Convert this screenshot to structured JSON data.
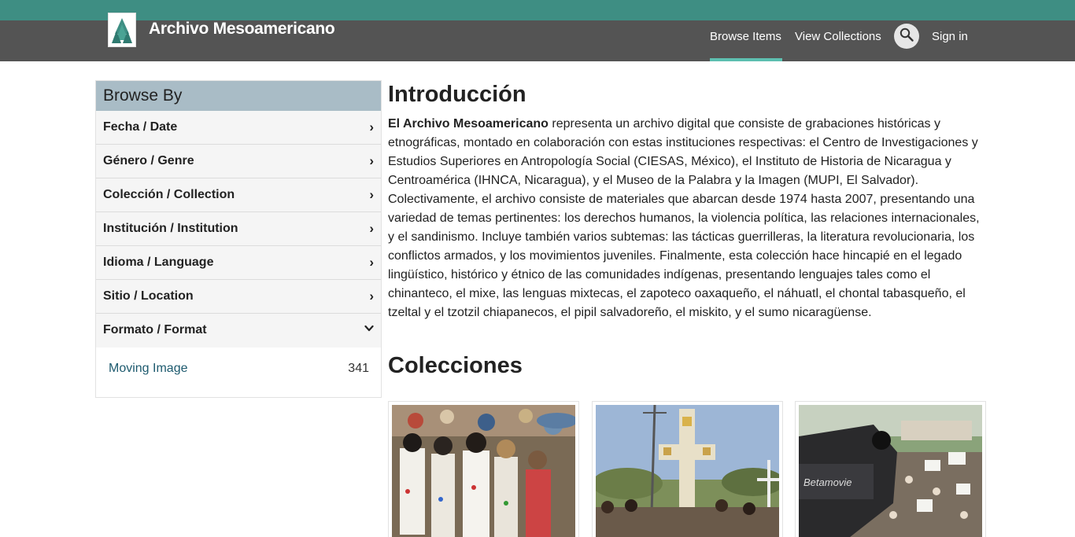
{
  "header": {
    "brand": "Archivo Mesoamericano",
    "nav": {
      "browse_items": "Browse Items",
      "view_collections": "View Collections",
      "sign_in": "Sign in"
    },
    "search_icon": "magnifier-icon",
    "colors": {
      "top_strip": "#3e8e83",
      "navbar": "#545454",
      "active_underline": "#5cbfb0"
    }
  },
  "sidebar": {
    "title": "Browse By",
    "facets": [
      {
        "label": "Fecha / Date",
        "icon": "chevron-right-icon",
        "glyph": "›"
      },
      {
        "label": "Género / Genre",
        "icon": "chevron-right-icon",
        "glyph": "›"
      },
      {
        "label": "Colección / Collection",
        "icon": "chevron-right-icon",
        "glyph": "›"
      },
      {
        "label": "Institución / Institution",
        "icon": "chevron-right-icon",
        "glyph": "›"
      },
      {
        "label": "Idioma / Language",
        "icon": "chevron-right-icon",
        "glyph": "›"
      },
      {
        "label": "Sitio / Location",
        "icon": "chevron-right-icon",
        "glyph": "›"
      },
      {
        "label": "Formato / Format",
        "icon": "chevron-down-icon",
        "glyph": "⌄"
      }
    ],
    "format_values": [
      {
        "label": "Moving Image",
        "count": "341"
      }
    ]
  },
  "main": {
    "intro_title": "Introducción",
    "intro_lead": "El Archivo Mesoamericano",
    "intro_body": " representa un archivo digital que consiste de grabaciones históricas y etnográficas, montado en colaboración con estas instituciones respectivas: el Centro de Investigaciones y Estudios Superiores en Antropología Social (CIESAS, México), el Instituto de Historia de Nicaragua y Centroamérica (IHNCA, Nicaragua), y el Museo de la Palabra y la Imagen (MUPI, El Salvador). Colectivamente, el archivo consiste de materiales que abarcan desde 1974 hasta 2007, presentando una variedad de temas pertinentes: los derechos humanos, la violencia política, las relaciones internacionales, y el sandinismo. Incluye también varios subtemas: las tácticas guerrilleras, la literatura revolucionaria, los conflictos armados, y los movimientos juveniles. Finalmente, esta colección hace hincapié en el legado lingüístico, histórico y étnico de las comunidades indígenas, presentando lenguajes tales como el chinanteco, el mixe, las lenguas mixtecas, el zapoteco oaxaqueño, el náhuatl, el chontal tabasqueño, el tzeltal y el tzotzil chiapanecos, el pipil salvadoreño, el miskito, y el sumo nicaragüense.",
    "collections_title": "Colecciones",
    "collection_cards": [
      {
        "image": "crowd-festival-photo"
      },
      {
        "image": "cross-monument-photo"
      },
      {
        "image": "camera-protest-photo",
        "camera_text": "Betamovie"
      }
    ]
  }
}
